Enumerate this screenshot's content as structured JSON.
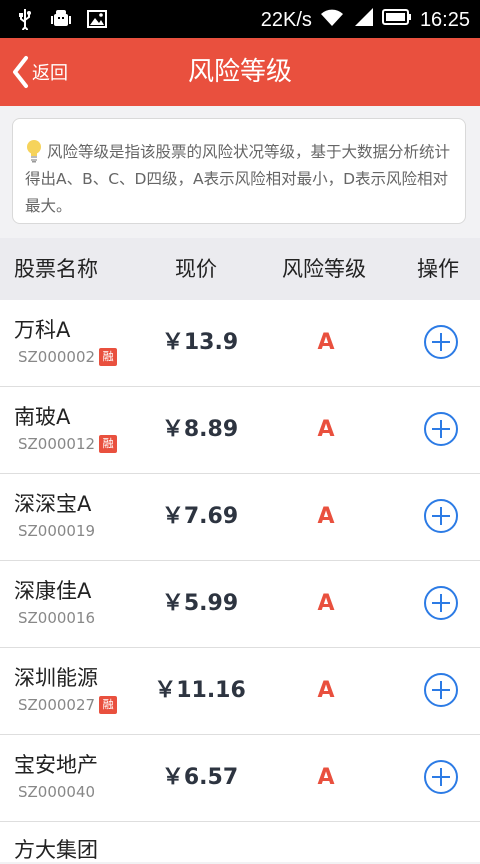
{
  "status_bar": {
    "speed": "22K/s",
    "time": "16:25"
  },
  "header": {
    "back_label": "返回",
    "title": "风险等级"
  },
  "info": {
    "text": "风险等级是指该股票的风险状况等级，基于大数据分析统计得出A、B、C、D四级，A表示风险相对最小，D表示风险相对最大。"
  },
  "table": {
    "headers": [
      "股票名称",
      "现价",
      "风险等级",
      "操作"
    ],
    "rows": [
      {
        "name": "万科A",
        "code": "SZ000002",
        "badge": "融",
        "price": "￥13.9",
        "risk": "A"
      },
      {
        "name": "南玻A",
        "code": "SZ000012",
        "badge": "融",
        "price": "￥8.89",
        "risk": "A"
      },
      {
        "name": "深深宝A",
        "code": "SZ000019",
        "badge": "",
        "price": "￥7.69",
        "risk": "A"
      },
      {
        "name": "深康佳A",
        "code": "SZ000016",
        "badge": "",
        "price": "￥5.99",
        "risk": "A"
      },
      {
        "name": "深圳能源",
        "code": "SZ000027",
        "badge": "融",
        "price": "￥11.16",
        "risk": "A"
      },
      {
        "name": "宝安地产",
        "code": "SZ000040",
        "badge": "",
        "price": "￥6.57",
        "risk": "A"
      }
    ],
    "partial_row_name": "方大集团"
  },
  "colors": {
    "accent": "#e9503e",
    "link": "#2c7be5"
  }
}
